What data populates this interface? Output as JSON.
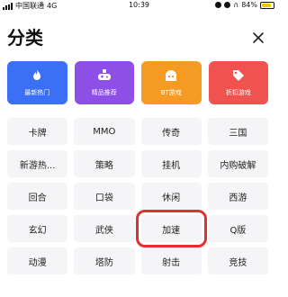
{
  "status_bar": {
    "carrier": "中国联通",
    "network": "4G",
    "time": "10:39",
    "battery_text": "84%",
    "battery_level": 0.84
  },
  "header": {
    "title": "分类",
    "close_icon": "close-icon"
  },
  "featured": [
    {
      "label": "最新热门",
      "icon": "flame-icon",
      "color": "#3b6ff5"
    },
    {
      "label": "精品推荐",
      "icon": "gamepad-icon",
      "color": "#8e4fe6"
    },
    {
      "label": "BT游戏",
      "icon": "bt-icon",
      "color": "#f59b23"
    },
    {
      "label": "折扣游戏",
      "icon": "tag-icon",
      "color": "#f0524f"
    }
  ],
  "categories": [
    "卡牌",
    "MMO",
    "传奇",
    "三国",
    "新游热...",
    "策略",
    "挂机",
    "内购破解",
    "回合",
    "口袋",
    "休闲",
    "西游",
    "玄幻",
    "武侠",
    "加速",
    "Q版",
    "动漫",
    "塔防",
    "射击",
    "竞技"
  ],
  "highlight_color": "#e03131"
}
